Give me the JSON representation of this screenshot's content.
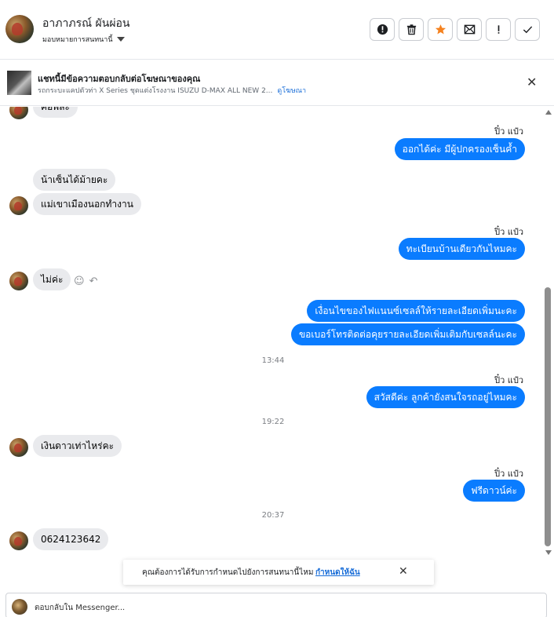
{
  "header": {
    "name": "อาภาภรณ์ ผันผ่อน",
    "assign_label": "มอบหมายการสนทนานี้",
    "actions": {
      "spam_icon": "alert-circle-icon",
      "delete_icon": "trash-icon",
      "star_icon": "star-icon",
      "unread_icon": "envelope-icon",
      "important_icon": "exclamation-icon",
      "done_icon": "check-icon"
    },
    "star_color": "#f5821f"
  },
  "ad": {
    "title": "แชทนี้มีข้อความตอบกลับต่อโฆษณาของคุณ",
    "desc": "รถกระบะแคปตัวท่า X Series ชุดแต่งโรงงาน ISUZU D-MAX ALL NEW 2...",
    "link": "ดูโฆษณา"
  },
  "messages": {
    "m0": "คือพี่ล่ะ",
    "sender1": "ปิ๋ว แป๋ว",
    "m1": "ออกได้ค่ะ  มีผู้ปกครองเซ็นค้ำ",
    "m2": "น้าเซ็นได้ม้ายคะ",
    "m3": "แม่เขาเมืองนอกทำงาน",
    "sender2": "ปิ๋ว แป๋ว",
    "m4": "ทะเบียนบ้านเดียวกันไหมคะ",
    "m5": "ไม่ค่ะ",
    "m6": "เงื่อนไขของไฟแนนซ์เซลล์ให้รายละเอียดเพิ่มนะคะ",
    "m7": "ขอเบอร์โทรติดต่อคุยรายละเอียดเพิ่มเติมกับเซลล์นะคะ",
    "time1": "13:44",
    "sender3": "ปิ๋ว แป๋ว",
    "m8": "สวัสดีค่ะ ลูกค้ายังสนใจรถอยู่ไหมคะ",
    "time2": "19:22",
    "m9": "เงินดาวเท่าไหร่คะ",
    "sender4": "ปิ๋ว แป๋ว",
    "m10": "ฟรีดาวน์ค่ะ",
    "time3": "20:37",
    "m11": "0624123642"
  },
  "reminder": {
    "text": "คุณต้องการได้รับการกำหนดไปยังการสนทนานี้ไหม",
    "action": "กำหนดให้ฉัน"
  },
  "composer": {
    "placeholder": "ตอบกลับใน Messenger..."
  },
  "colors": {
    "outgoing_bubble": "#0a7cff",
    "incoming_bubble": "#e9eaed",
    "link": "#1a6ed8"
  }
}
